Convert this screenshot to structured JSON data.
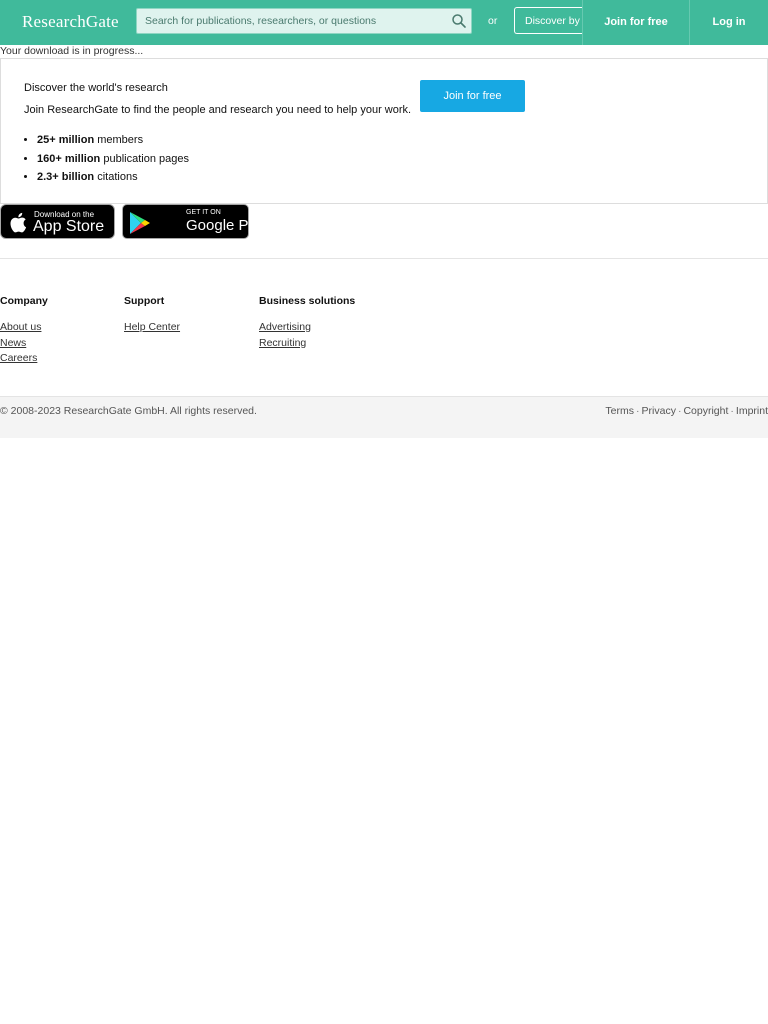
{
  "header": {
    "logo": "ResearchGate",
    "search_placeholder": "Search for publications, researchers, or questions",
    "or_label": "or",
    "discover_label": "Discover by",
    "join_label": "Join for free",
    "login_label": "Log in"
  },
  "download_status": "Your download is in progress...",
  "promo": {
    "heading": "Discover the world's research",
    "subheading": "Join ResearchGate to find the people and research you need to help your work.",
    "stats": [
      {
        "value": "25+ million",
        "label": "members"
      },
      {
        "value": "160+ million",
        "label": "publication pages"
      },
      {
        "value": "2.3+ billion",
        "label": "citations"
      }
    ],
    "join_label": "Join for free"
  },
  "app_badges": {
    "app_store_small": "Download on the",
    "app_store_big": "App Store",
    "play_small": "GET IT ON",
    "play_big": "Google Play"
  },
  "footer": {
    "columns": [
      {
        "title": "Company",
        "links": [
          "About us",
          "News",
          "Careers"
        ]
      },
      {
        "title": "Support",
        "links": [
          "Help Center"
        ]
      },
      {
        "title": "Business solutions",
        "links": [
          "Advertising",
          "Recruiting"
        ]
      }
    ],
    "copyright": "© 2008-2023 ResearchGate GmbH. All rights reserved.",
    "legal_links": [
      "Terms",
      "Privacy",
      "Copyright",
      "Imprint"
    ],
    "separator": "·"
  },
  "colors": {
    "brand": "#40ba9b",
    "button_blue": "#17a8e3"
  },
  "icons": {
    "search": "search-icon",
    "apple": "apple-icon",
    "play": "google-play-icon"
  }
}
